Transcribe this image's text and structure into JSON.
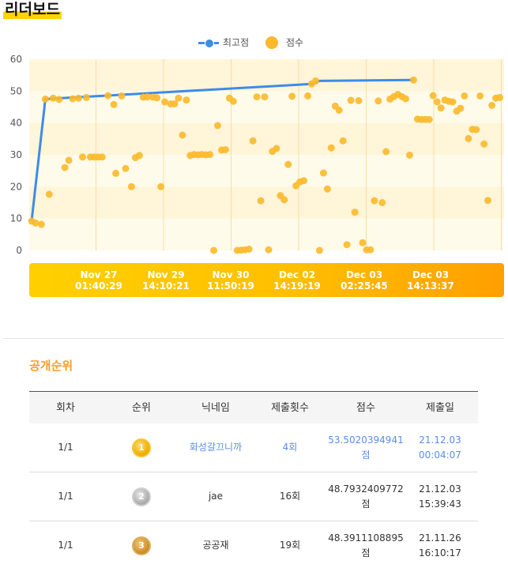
{
  "page_title": "리더보드",
  "legend": {
    "best_label": "최고점",
    "score_label": "점수"
  },
  "colors": {
    "best_line": "#3d8bea",
    "score_point": "#fcb92b",
    "accent": "#f59d2a",
    "link": "#5b8ee8",
    "navigator_start": "#ffd000",
    "navigator_end": "#ff9f00"
  },
  "chart_data": {
    "type": "scatter",
    "ylim": [
      0,
      60
    ],
    "yticks": [
      0,
      10,
      20,
      30,
      40,
      50,
      60
    ],
    "x_index_range": [
      0,
      240
    ],
    "grid": true,
    "legend_position": "top-center",
    "series": [
      {
        "name": "최고점",
        "type": "line",
        "points": [
          [
            0,
            9.2
          ],
          [
            7,
            47.5
          ],
          [
            144,
            52.3
          ],
          [
            147,
            53.2
          ],
          [
            195,
            53.5
          ]
        ]
      },
      {
        "name": "점수",
        "type": "scatter",
        "points": [
          [
            0,
            9.2
          ],
          [
            2,
            8.6
          ],
          [
            5,
            8.2
          ],
          [
            7,
            47.5
          ],
          [
            9,
            17.6
          ],
          [
            11,
            47.8
          ],
          [
            14,
            47.4
          ],
          [
            17,
            26
          ],
          [
            19,
            28.3
          ],
          [
            21,
            47.6
          ],
          [
            24,
            47.8
          ],
          [
            26,
            29.3
          ],
          [
            28,
            48
          ],
          [
            30,
            29.3
          ],
          [
            32,
            29.3
          ],
          [
            34,
            29.3
          ],
          [
            36,
            29.3
          ],
          [
            39,
            48.6
          ],
          [
            42,
            45.8
          ],
          [
            43,
            24.2
          ],
          [
            46,
            48.5
          ],
          [
            48,
            25.7
          ],
          [
            51,
            20
          ],
          [
            53,
            29.1
          ],
          [
            55,
            29.8
          ],
          [
            57,
            48.1
          ],
          [
            59,
            48.2
          ],
          [
            62,
            48.1
          ],
          [
            64,
            47.9
          ],
          [
            66,
            20
          ],
          [
            68,
            46.6
          ],
          [
            71,
            46
          ],
          [
            73,
            46
          ],
          [
            75,
            47.8
          ],
          [
            77,
            36.2
          ],
          [
            79,
            47.2
          ],
          [
            81,
            29.8
          ],
          [
            83,
            30.1
          ],
          [
            85,
            30
          ],
          [
            87,
            30.1
          ],
          [
            89,
            30
          ],
          [
            91,
            30.1
          ],
          [
            93,
            0
          ],
          [
            95,
            39.2
          ],
          [
            97,
            31.5
          ],
          [
            99,
            31.6
          ],
          [
            101,
            47.8
          ],
          [
            103,
            46.8
          ],
          [
            105,
            0
          ],
          [
            107,
            0.1
          ],
          [
            109,
            0.2
          ],
          [
            111,
            0.4
          ],
          [
            113,
            34.4
          ],
          [
            115,
            48.2
          ],
          [
            117,
            15.6
          ],
          [
            119,
            48.2
          ],
          [
            121,
            0.2
          ],
          [
            123,
            31.1
          ],
          [
            125,
            32
          ],
          [
            127,
            17.2
          ],
          [
            129,
            15.9
          ],
          [
            131,
            27
          ],
          [
            133,
            48.4
          ],
          [
            135,
            20.3
          ],
          [
            137,
            21.5
          ],
          [
            139,
            21.9
          ],
          [
            141,
            48.5
          ],
          [
            143,
            52.3
          ],
          [
            145,
            53.2
          ],
          [
            147,
            0
          ],
          [
            149,
            24.3
          ],
          [
            151,
            19.3
          ],
          [
            153,
            32.2
          ],
          [
            155,
            45.3
          ],
          [
            157,
            44
          ],
          [
            159,
            34.4
          ],
          [
            161,
            1.8
          ],
          [
            163,
            47.1
          ],
          [
            165,
            12
          ],
          [
            167,
            47
          ],
          [
            169,
            2.4
          ],
          [
            171,
            0.2
          ],
          [
            173,
            0.2
          ],
          [
            175,
            15.6
          ],
          [
            177,
            46.9
          ],
          [
            179,
            15
          ],
          [
            181,
            31
          ],
          [
            183,
            47.5
          ],
          [
            185,
            48.3
          ],
          [
            187,
            49
          ],
          [
            189,
            48.3
          ],
          [
            191,
            47.6
          ],
          [
            193,
            29.9
          ],
          [
            195,
            53.5
          ],
          [
            197,
            41.2
          ],
          [
            199,
            41.1
          ],
          [
            201,
            41.1
          ],
          [
            203,
            41.1
          ],
          [
            205,
            48.6
          ],
          [
            207,
            46.6
          ],
          [
            209,
            44.7
          ],
          [
            211,
            47.2
          ],
          [
            213,
            46.8
          ],
          [
            215,
            46.6
          ],
          [
            217,
            43.7
          ],
          [
            219,
            44.6
          ],
          [
            221,
            48.5
          ],
          [
            223,
            35.1
          ],
          [
            225,
            38
          ],
          [
            227,
            37.9
          ],
          [
            229,
            48.5
          ],
          [
            231,
            33.4
          ],
          [
            233,
            15.7
          ],
          [
            235,
            45.5
          ],
          [
            237,
            47.8
          ],
          [
            239,
            48
          ]
        ]
      }
    ]
  },
  "navigator_labels": [
    {
      "date": "Nov 27",
      "time": "01:40:29"
    },
    {
      "date": "Nov 29",
      "time": "14:10:21"
    },
    {
      "date": "Nov 30",
      "time": "11:50:19"
    },
    {
      "date": "Dec 02",
      "time": "14:19:19"
    },
    {
      "date": "Dec 03",
      "time": "02:25:45"
    },
    {
      "date": "Dec 03",
      "time": "14:13:37"
    }
  ],
  "ranking": {
    "title": "공개순위",
    "headers": {
      "round": "회차",
      "rank": "순위",
      "nickname": "닉네임",
      "submissions": "제출횟수",
      "score": "점수",
      "submitted_at": "제출일"
    },
    "rows": [
      {
        "round": "1/1",
        "rank": "1",
        "medal": "gold",
        "nickname": "화성갈끄니까",
        "submissions": "4회",
        "score": "53.5020394941",
        "score_unit": "점",
        "date": "21.12.03",
        "time": "00:04:07",
        "highlight": true
      },
      {
        "round": "1/1",
        "rank": "2",
        "medal": "silver",
        "nickname": "jae",
        "submissions": "16회",
        "score": "48.7932409772",
        "score_unit": "점",
        "date": "21.12.03",
        "time": "15:39:43",
        "highlight": false
      },
      {
        "round": "1/1",
        "rank": "3",
        "medal": "bronze",
        "nickname": "공공재",
        "submissions": "19회",
        "score": "48.3911108895",
        "score_unit": "점",
        "date": "21.11.26",
        "time": "16:10:17",
        "highlight": false
      }
    ]
  }
}
